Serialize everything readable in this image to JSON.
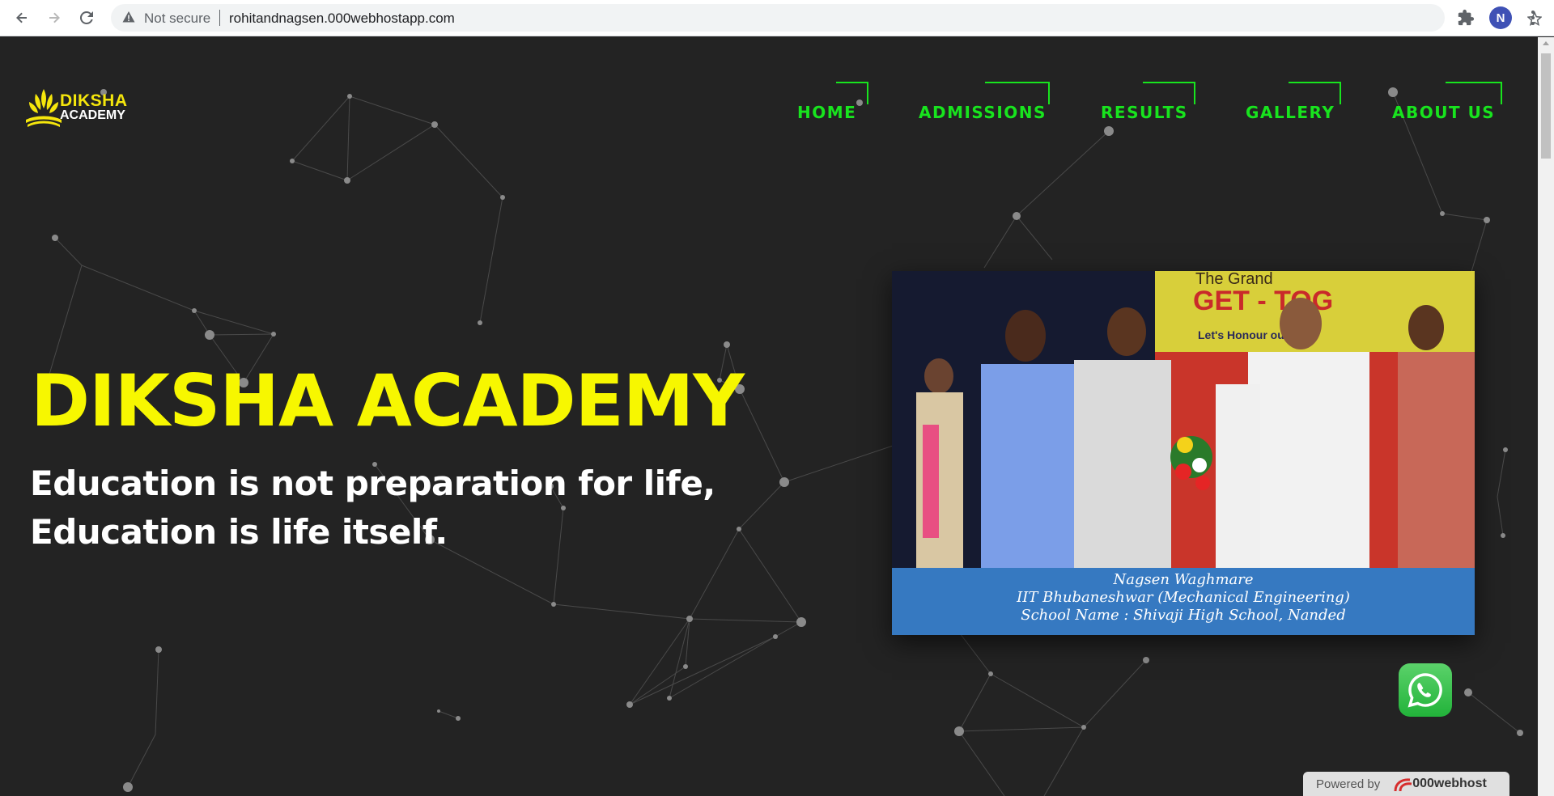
{
  "browser": {
    "security_label": "Not secure",
    "url": "rohitandnagsen.000webhostapp.com",
    "profile_initial": "N"
  },
  "logo": {
    "line1": "DIKSHA",
    "line2": "ACADEMY"
  },
  "nav": {
    "items": [
      {
        "label": "HOME"
      },
      {
        "label": "ADMISSIONS"
      },
      {
        "label": "RESULTS"
      },
      {
        "label": "GALLERY"
      },
      {
        "label": "ABOUT US"
      }
    ]
  },
  "hero": {
    "title": "DIKSHA ACADEMY",
    "quote_line1": "Education is not preparation for life,",
    "quote_line2": "Education is life itself."
  },
  "card": {
    "banner_line1": "The Grand",
    "banner_line2": "GET - TOG",
    "banner_line3": "Let's Honour our IIT",
    "caption_name": "Nagsen Waghmare",
    "caption_college": "IIT Bhubaneshwar (Mechanical Engineering)",
    "caption_school": "School Name : Shivaji High School, Nanded"
  },
  "footer": {
    "powered_by": "Powered by",
    "host_brand": "000webhost"
  },
  "colors": {
    "background": "#232323",
    "nav_green": "#18e41e",
    "title_yellow": "#f7f700",
    "caption_blue": "#3679c1"
  }
}
